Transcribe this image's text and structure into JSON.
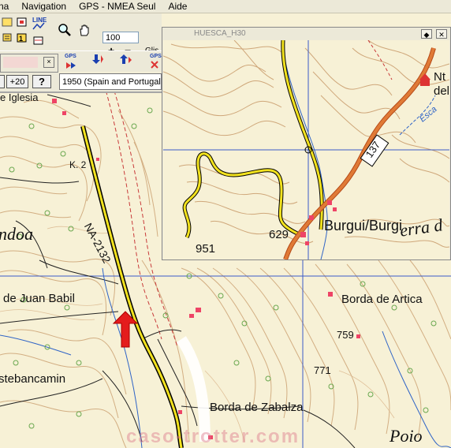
{
  "menu": {
    "items": [
      "na",
      "Navigation",
      "GPS - NMEA Seul",
      "Aide"
    ]
  },
  "toolbar": {
    "zoom_value": "100",
    "zoom_in": "+",
    "zoom_out": "−",
    "glis_label": "Glis",
    "line_label": "LINE",
    "gps_label": "GPS"
  },
  "buttons": {
    "plus20": "+20",
    "help": "?",
    "datum": "1950 (Spain and Portugal)"
  },
  "miniwindow": {
    "title": "HUESCA_H30",
    "btn_menu": "◆",
    "btn_close": "✕"
  },
  "map_labels": {
    "iglesia": "e Iglesia",
    "k2": "K. 2",
    "ndoa": "ndoa",
    "na2132": "NA-2132",
    "juan_babil": "de Juan Babil",
    "borda_artica": "Borda de Artica",
    "n759": "759",
    "n771": "771",
    "stebancamin": "stebancamin",
    "borda_zabalza": "Borda de Zabalza",
    "poio": "Poio",
    "watermark": "caso-trotter.com"
  },
  "mini_labels": {
    "road137": "137",
    "burgui": "Burgui/Burgi",
    "n629": "629",
    "n951": "951",
    "nt": "Nt",
    "del": "del",
    "sierra": "erra d",
    "river": "Esca"
  },
  "colors": {
    "road_yellow": "#f2e21e",
    "road_orange": "#d8642a",
    "contour": "#c99a6a",
    "grid": "#3b5bc8",
    "river": "#2e63c6",
    "arrow": "#e41c1c"
  }
}
